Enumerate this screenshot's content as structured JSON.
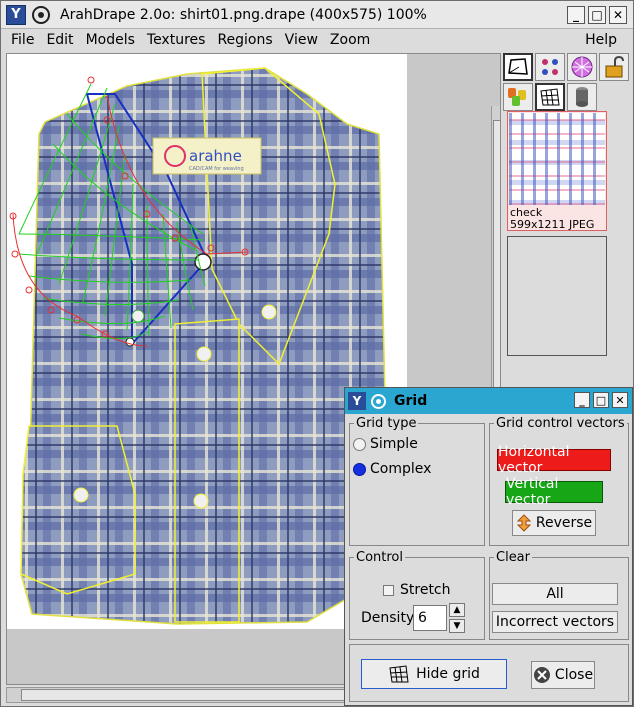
{
  "window": {
    "title": "ArahDrape 2.0o: shirt01.png.drape (400x575) 100%",
    "app_icon_glyph": "Y",
    "controls": [
      "_",
      "□",
      "✕"
    ]
  },
  "menu": {
    "items": [
      "File",
      "Edit",
      "Models",
      "Textures",
      "Regions",
      "View",
      "Zoom"
    ],
    "help": "Help"
  },
  "canvas": {
    "logo_text": "arahne",
    "logo_tagline": "CAD/CAM for weaving"
  },
  "side_panel": {
    "tools_row1": [
      "region-tool-icon",
      "dots-tool-icon",
      "texture-ball-icon",
      "unlock-icon"
    ],
    "tools_row2": [
      "masks-icon",
      "grid-tool-icon",
      "cylinder-icon"
    ],
    "texture": {
      "name": "check",
      "info": "599x1211 JPEG"
    }
  },
  "grid_dialog": {
    "title": "Grid",
    "app_icon_glyph": "Y",
    "grid_type": {
      "legend": "Grid type",
      "options": [
        "Simple",
        "Complex"
      ],
      "selected": "Complex"
    },
    "control_vectors": {
      "legend": "Grid control vectors",
      "horizontal": "Horizontal vector",
      "vertical": "Vertical vector",
      "reverse": "Reverse"
    },
    "control": {
      "legend": "Control",
      "stretch": "Stretch",
      "density_label": "Density",
      "density_value": "6"
    },
    "clear": {
      "legend": "Clear",
      "all": "All",
      "incorrect": "Incorrect vectors"
    },
    "hide_grid": "Hide grid",
    "close": "Close"
  },
  "colors": {
    "horizontal_vector": "#ee1b1b",
    "vertical_vector": "#16a616",
    "dialog_title": "#2aa6d0",
    "radio_selected": "#1230e0"
  }
}
